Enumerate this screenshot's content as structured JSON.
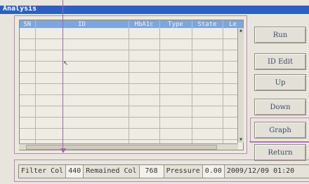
{
  "window": {
    "title": "Analysis"
  },
  "table": {
    "columns": [
      "SN",
      "ID",
      "HbA1c",
      "Type",
      "State",
      "Le"
    ],
    "row_count": 11
  },
  "buttons": {
    "run": "Run",
    "id_edit": "ID Edit",
    "up": "Up",
    "down": "Down",
    "graph": "Graph",
    "return": "Return"
  },
  "status": {
    "filter_label": "Filter Col",
    "filter_value": "440",
    "remained_label": "Remained Col",
    "remained_value": "768",
    "pressure_label": "Pressure",
    "pressure_value": "0.00",
    "datetime": "2009/12/09  01:20"
  },
  "colors": {
    "titlebar": "#2d5fc8",
    "header": "#7fa6d8",
    "annotation": "#a066a8"
  }
}
